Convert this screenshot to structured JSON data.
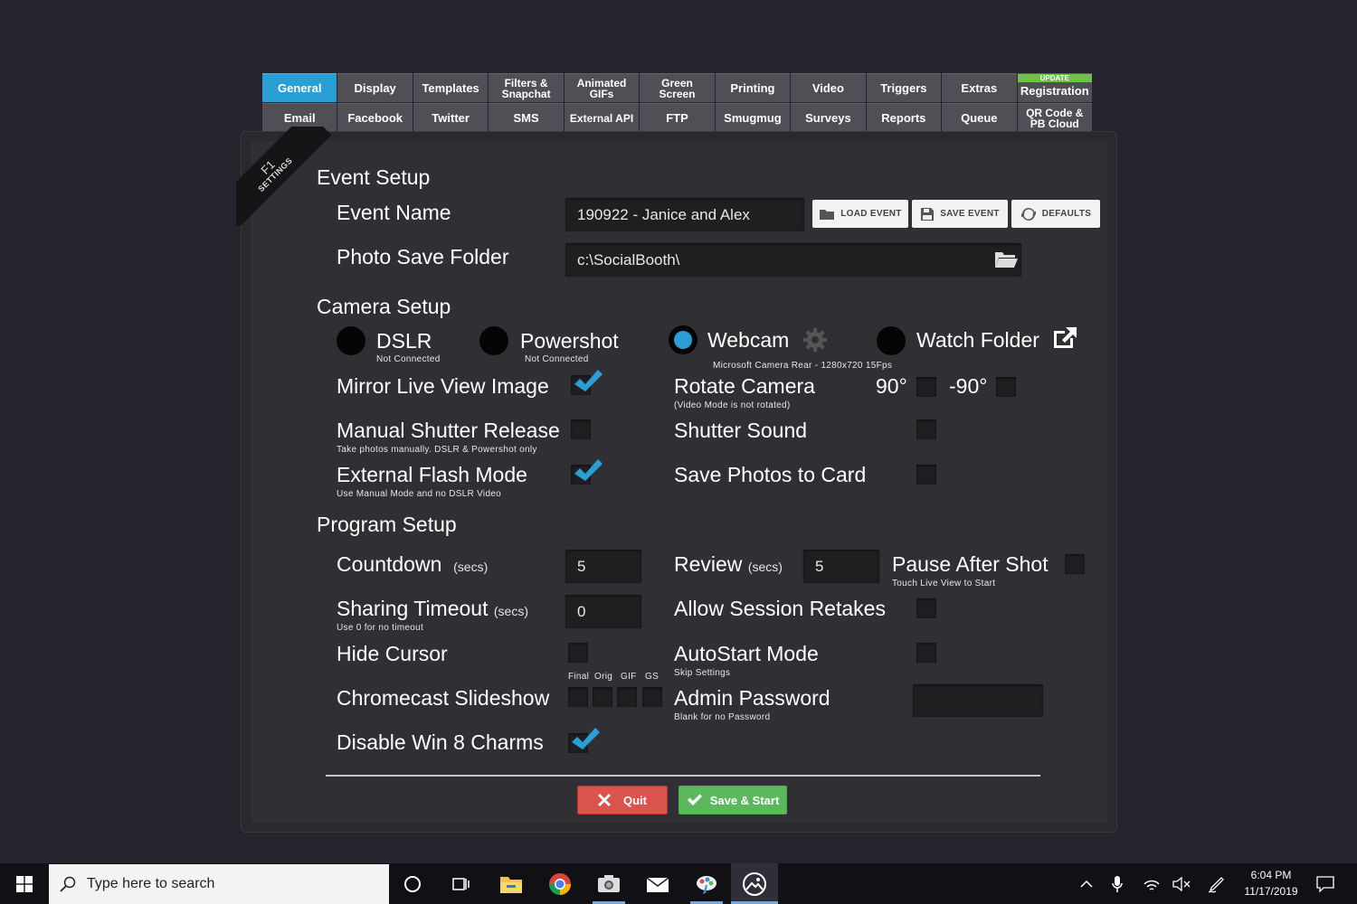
{
  "tabs": {
    "row1": [
      {
        "label": "General",
        "active": true
      },
      {
        "label": "Display"
      },
      {
        "label": "Templates"
      },
      {
        "label": "Filters &\nSnapchat"
      },
      {
        "label": "Animated\nGIFs"
      },
      {
        "label": "Green\nScreen"
      },
      {
        "label": "Printing"
      },
      {
        "label": "Video"
      },
      {
        "label": "Triggers"
      },
      {
        "label": "Extras"
      },
      {
        "label": "Registration",
        "badge": "UPDATE"
      }
    ],
    "row2": [
      {
        "label": "Email"
      },
      {
        "label": "Facebook"
      },
      {
        "label": "Twitter"
      },
      {
        "label": "SMS"
      },
      {
        "label": "External API"
      },
      {
        "label": "FTP"
      },
      {
        "label": "Smugmug"
      },
      {
        "label": "Surveys"
      },
      {
        "label": "Reports"
      },
      {
        "label": "Queue"
      },
      {
        "label": "QR Code &\nPB Cloud"
      }
    ]
  },
  "ribbon": {
    "key": "F1",
    "label": "SETTINGS"
  },
  "event_setup": {
    "title": "Event Setup",
    "event_name_label": "Event Name",
    "event_name_value": "190922 - Janice and Alex",
    "load_event": "LOAD EVENT",
    "save_event": "SAVE EVENT",
    "defaults": "DEFAULTS",
    "photo_folder_label": "Photo Save Folder",
    "photo_folder_value": "c:\\SocialBooth\\"
  },
  "camera_setup": {
    "title": "Camera Setup",
    "options": [
      {
        "label": "DSLR",
        "status": "Not Connected",
        "selected": false
      },
      {
        "label": "Powershot",
        "status": "Not Connected",
        "selected": false
      },
      {
        "label": "Webcam",
        "status": "Microsoft Camera Rear - 1280x720 15Fps",
        "selected": true
      },
      {
        "label": "Watch Folder",
        "status": "",
        "selected": false
      }
    ],
    "mirror_label": "Mirror Live View Image",
    "mirror_checked": true,
    "rotate_label": "Rotate Camera",
    "rotate_sub": "(Video Mode is not rotated)",
    "rotate_90": "90°",
    "rotate_neg90": "-90°",
    "manual_shutter_label": "Manual Shutter Release",
    "manual_shutter_sub": "Take photos manually.  DSLR & Powershot only",
    "manual_shutter_checked": false,
    "shutter_sound_label": "Shutter Sound",
    "shutter_sound_checked": false,
    "flash_label": "External Flash Mode",
    "flash_sub": "Use Manual Mode and no DSLR Video",
    "flash_checked": true,
    "save_card_label": "Save Photos to Card",
    "save_card_checked": false
  },
  "program_setup": {
    "title": "Program Setup",
    "countdown_label": "Countdown",
    "countdown_unit": "(secs)",
    "countdown_value": "5",
    "review_label": "Review",
    "review_unit": "(secs)",
    "review_value": "5",
    "pause_label": "Pause After Shot",
    "pause_sub": "Touch Live View to Start",
    "sharing_label": "Sharing Timeout",
    "sharing_unit": "(secs)",
    "sharing_sub": "Use 0 for no timeout",
    "sharing_value": "0",
    "retakes_label": "Allow Session Retakes",
    "hide_cursor_label": "Hide Cursor",
    "autostart_label": "AutoStart Mode",
    "autostart_sub": "Skip Settings",
    "chromecast_label": "Chromecast Slideshow",
    "chromecast_cols": [
      "Final",
      "Orig",
      "GIF",
      "GS"
    ],
    "admin_label": "Admin Password",
    "admin_sub": "Blank for no Password",
    "admin_value": "",
    "win8_label": "Disable Win 8 Charms",
    "win8_checked": true
  },
  "actions": {
    "quit": "Quit",
    "save_start": "Save & Start"
  },
  "taskbar": {
    "search_placeholder": "Type here to search",
    "time": "6:04 PM",
    "date": "11/17/2019"
  },
  "colors": {
    "accent": "#2a9fd6",
    "quit": "#d9534f",
    "save": "#5cb85c",
    "badge": "#6cc24a"
  }
}
